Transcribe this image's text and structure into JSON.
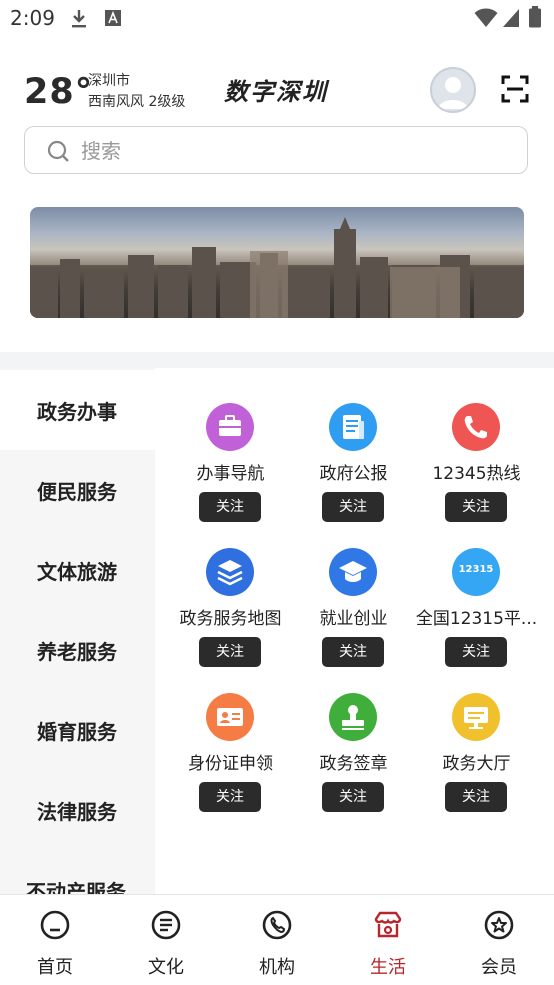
{
  "status_bar": {
    "time": "2:09"
  },
  "header": {
    "temperature": "28°",
    "city": "深圳市",
    "wind": "西南风风 2级级",
    "logo_text": "数字深圳"
  },
  "search": {
    "placeholder": "搜索"
  },
  "sidebar": {
    "items": [
      {
        "label": "政务办事",
        "active": true
      },
      {
        "label": "便民服务"
      },
      {
        "label": "文体旅游"
      },
      {
        "label": "养老服务"
      },
      {
        "label": "婚育服务"
      },
      {
        "label": "法律服务"
      },
      {
        "label": "不动产服务"
      }
    ]
  },
  "services": [
    {
      "label": "办事导航",
      "icon": "briefcase-icon",
      "color": "#c061d8",
      "follow": "关注"
    },
    {
      "label": "政府公报",
      "icon": "document-icon",
      "color": "#2f9ef2",
      "follow": "关注"
    },
    {
      "label": "12345热线",
      "icon": "phone-icon",
      "color": "#ef5552",
      "follow": "关注"
    },
    {
      "label": "政务服务地图",
      "icon": "layers-icon",
      "color": "#2f6fe0",
      "follow": "关注"
    },
    {
      "label": "就业创业",
      "icon": "graduation-cap-icon",
      "color": "#2f78e6",
      "follow": "关注"
    },
    {
      "label": "全国12315平...",
      "icon": "badge-12315-icon",
      "icon_text": "12315",
      "color": "#35a6f4",
      "follow": "关注"
    },
    {
      "label": "身份证申领",
      "icon": "id-card-icon",
      "color": "#f57c45",
      "follow": "关注"
    },
    {
      "label": "政务签章",
      "icon": "stamp-icon",
      "color": "#3fae3a",
      "follow": "关注"
    },
    {
      "label": "政务大厅",
      "icon": "monitor-icon",
      "color": "#f1c12d",
      "follow": "关注"
    }
  ],
  "bottom_nav": {
    "items": [
      {
        "label": "首页",
        "icon": "home-face-icon"
      },
      {
        "label": "文化",
        "icon": "culture-doc-icon"
      },
      {
        "label": "机构",
        "icon": "institution-phone-icon"
      },
      {
        "label": "生活",
        "icon": "life-shop-icon",
        "active": true
      },
      {
        "label": "会员",
        "icon": "member-star-icon"
      }
    ]
  },
  "colors": {
    "accent": "#b8262b",
    "button_bg": "#2b2b2b",
    "sidebar_bg": "#f6f6f7"
  }
}
